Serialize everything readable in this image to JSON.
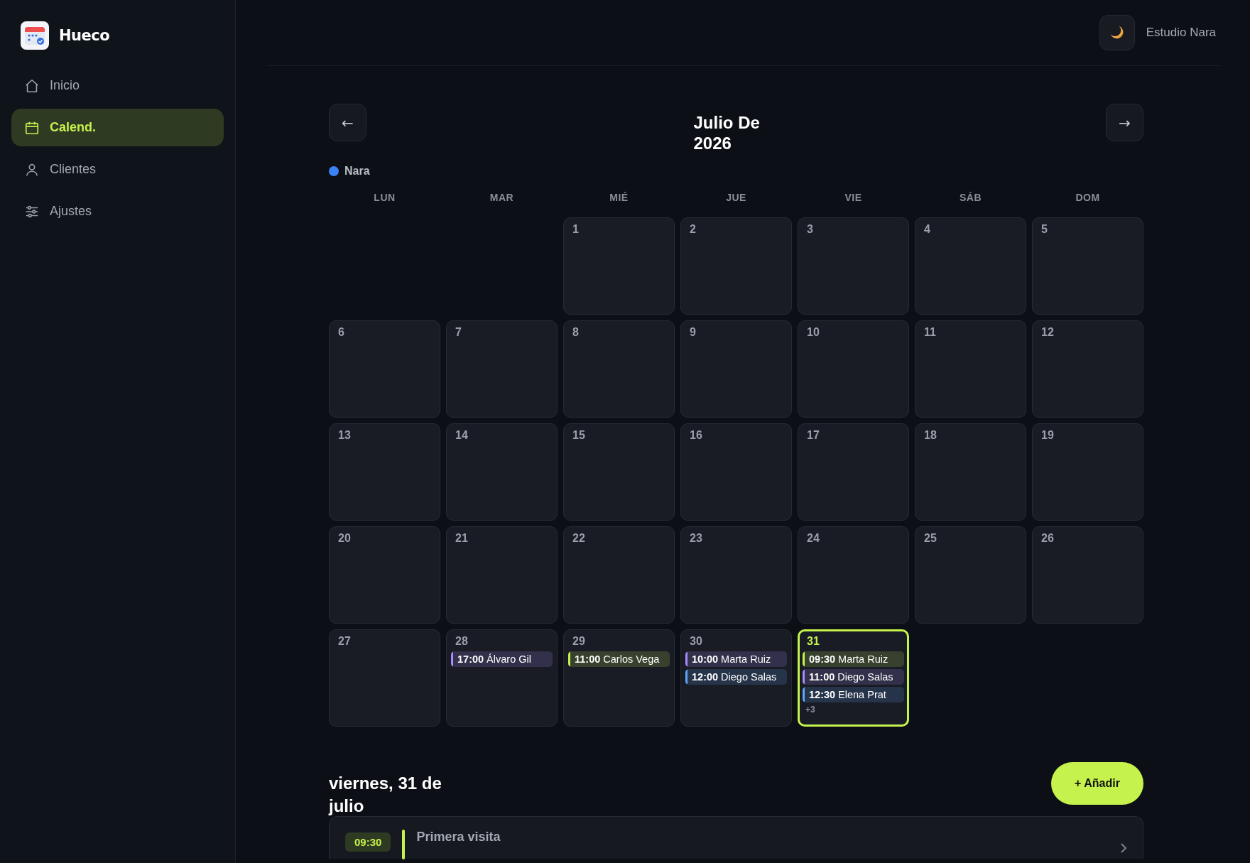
{
  "sidebar": {
    "brand": "Hueco",
    "items": [
      {
        "label": "Inicio",
        "selected": false
      },
      {
        "label": "Calend.",
        "selected": true
      },
      {
        "label": "Clientes",
        "selected": false
      },
      {
        "label": "Ajustes",
        "selected": false
      }
    ]
  },
  "header": {
    "studio": "Estudio Nara"
  },
  "calendar": {
    "prev": "←",
    "next": "→",
    "title": "Julio De 2026",
    "legend": [
      {
        "name": "Nara",
        "color": "#3b82f6"
      }
    ],
    "weekdays": [
      "LUN",
      "MAR",
      "MIÉ",
      "JUE",
      "VIE",
      "SÁB",
      "DOM"
    ],
    "days": [
      {
        "kind": "empty"
      },
      {
        "kind": "empty"
      },
      {
        "kind": "day",
        "label": "1",
        "selected": false
      },
      {
        "kind": "day",
        "label": "2",
        "selected": false
      },
      {
        "kind": "day",
        "label": "3",
        "selected": false
      },
      {
        "kind": "day",
        "label": "4",
        "selected": false
      },
      {
        "kind": "day",
        "label": "5",
        "selected": false
      },
      {
        "kind": "day",
        "label": "6",
        "selected": false
      },
      {
        "kind": "day",
        "label": "7",
        "selected": false
      },
      {
        "kind": "day",
        "label": "8",
        "selected": false
      },
      {
        "kind": "day",
        "label": "9",
        "selected": false
      },
      {
        "kind": "day",
        "label": "10",
        "selected": false
      },
      {
        "kind": "day",
        "label": "11",
        "selected": false
      },
      {
        "kind": "day",
        "label": "12",
        "selected": false
      },
      {
        "kind": "day",
        "label": "13",
        "selected": false
      },
      {
        "kind": "day",
        "label": "14",
        "selected": false
      },
      {
        "kind": "day",
        "label": "15",
        "selected": false
      },
      {
        "kind": "day",
        "label": "16",
        "selected": false
      },
      {
        "kind": "day",
        "label": "17",
        "selected": false
      },
      {
        "kind": "day",
        "label": "18",
        "selected": false
      },
      {
        "kind": "day",
        "label": "19",
        "selected": false
      },
      {
        "kind": "day",
        "label": "20",
        "selected": false
      },
      {
        "kind": "day",
        "label": "21",
        "selected": false
      },
      {
        "kind": "day",
        "label": "22",
        "selected": false
      },
      {
        "kind": "day",
        "label": "23",
        "selected": false
      },
      {
        "kind": "day",
        "label": "24",
        "selected": false
      },
      {
        "kind": "day",
        "label": "25",
        "selected": false
      },
      {
        "kind": "day",
        "label": "26",
        "selected": false
      },
      {
        "kind": "day",
        "label": "27",
        "selected": false
      },
      {
        "kind": "day",
        "label": "28",
        "selected": false,
        "events": [
          {
            "time": "17:00",
            "name": "Álvaro Gil",
            "color": "#a78bfa"
          }
        ]
      },
      {
        "kind": "day",
        "label": "29",
        "selected": false,
        "events": [
          {
            "time": "11:00",
            "name": "Carlos Vega",
            "color": "#c6f24e"
          }
        ]
      },
      {
        "kind": "day",
        "label": "30",
        "selected": false,
        "events": [
          {
            "time": "10:00",
            "name": "Marta Ruiz",
            "color": "#a78bfa"
          },
          {
            "time": "12:00",
            "name": "Diego Salas",
            "color": "#60a5fa"
          }
        ]
      },
      {
        "kind": "day",
        "label": "31",
        "selected": true,
        "events": [
          {
            "time": "09:30",
            "name": "Marta Ruiz",
            "color": "#c6f24e"
          },
          {
            "time": "11:00",
            "name": "Diego Salas",
            "color": "#a78bfa"
          },
          {
            "time": "12:30",
            "name": "Elena Prat",
            "color": "#60a5fa"
          }
        ],
        "more": "+3"
      }
    ]
  },
  "day_panel": {
    "heading": "viernes, 31 de julio",
    "add_button": "+ Añadir",
    "appointments": [
      {
        "time": "09:30",
        "title": "Primera visita",
        "color": "#c6f24e"
      }
    ]
  }
}
